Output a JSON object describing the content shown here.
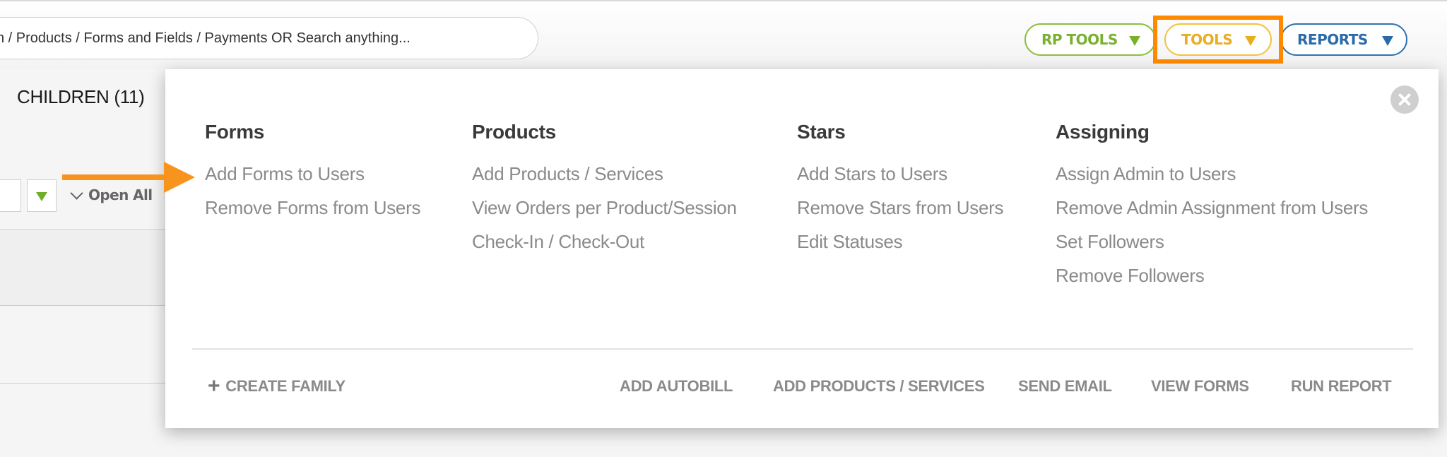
{
  "search": {
    "placeholder": "n / Products / Forms and Fields / Payments OR Search anything..."
  },
  "header": {
    "rp_tools_label": "RP TOOLS",
    "tools_label": "TOOLS",
    "reports_label": "REPORTS"
  },
  "left": {
    "children_title": "CHILDREN (11)",
    "open_all_label": "Open All"
  },
  "menu": {
    "columns": [
      {
        "heading": "Forms",
        "items": [
          "Add Forms to Users",
          "Remove Forms from Users"
        ]
      },
      {
        "heading": "Products",
        "items": [
          "Add Products / Services",
          "View Orders per Product/Session",
          "Check-In / Check-Out"
        ]
      },
      {
        "heading": "Stars",
        "items": [
          "Add Stars to Users",
          "Remove Stars from Users",
          "Edit Statuses"
        ]
      },
      {
        "heading": "Assigning",
        "items": [
          "Assign Admin to Users",
          "Remove Admin Assignment from Users",
          "Set Followers",
          "Remove Followers"
        ]
      }
    ],
    "footer": {
      "create_family": "CREATE FAMILY",
      "add_autobill": "ADD AUTOBILL",
      "add_products_services": "ADD PRODUCTS / SERVICES",
      "send_email": "SEND EMAIL",
      "view_forms": "VIEW FORMS",
      "run_report": "RUN REPORT"
    }
  },
  "colors": {
    "rp_tools": "#79b12e",
    "tools": "#e9ad22",
    "reports": "#2a6aa8",
    "highlight": "#ff8a00",
    "arrow": "#f7941d"
  }
}
